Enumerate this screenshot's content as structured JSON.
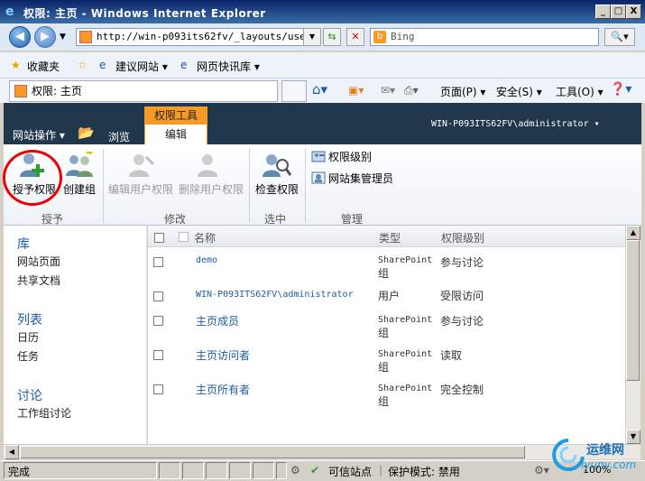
{
  "window": {
    "title": "权限: 主页 - Windows Internet Explorer",
    "min": "_",
    "max": "□",
    "close": "X"
  },
  "nav": {
    "address": "http://win-p093its62fv/_layouts/user.a",
    "search_placeholder": "Bing"
  },
  "favorites": {
    "label": "收藏夹",
    "items": [
      "建议网站 ▾",
      "网页快讯库 ▾"
    ]
  },
  "tab": {
    "title": "权限: 主页"
  },
  "commands": {
    "page": "页面(P) ▾",
    "safety": "安全(S) ▾",
    "tools": "工具(O) ▾"
  },
  "sharepoint": {
    "site_actions": "网站操作 ▾",
    "browse": "浏览",
    "tool_context": "权限工具",
    "edit_tab": "编辑",
    "user": "WIN-P093ITS62FV\\administrator ▾"
  },
  "ribbon": {
    "grant": "授予权限",
    "create_group": "创建组",
    "edit_perm": "编辑用户权限",
    "remove_perm": "删除用户权限",
    "check_perm": "检查权限",
    "perm_levels": "权限级别",
    "site_admins": "网站集管理员",
    "groups": {
      "grant": "授予",
      "modify": "修改",
      "check": "选中",
      "manage": "管理"
    }
  },
  "leftnav": {
    "libraries": "库",
    "lib_items": [
      "网站页面",
      "共享文档"
    ],
    "lists": "列表",
    "list_items": [
      "日历",
      "任务"
    ],
    "discussions": "讨论",
    "disc_items": [
      "工作组讨论"
    ]
  },
  "list": {
    "headers": {
      "name": "名称",
      "type": "类型",
      "level": "权限级别"
    },
    "rows": [
      {
        "name": "demo",
        "type": [
          "SharePoint",
          "组"
        ],
        "level": "参与讨论"
      },
      {
        "name": "WIN-P093ITS62FV\\administrator",
        "type": [
          "用户"
        ],
        "level": "受限访问"
      },
      {
        "name": "主页成员",
        "type": [
          "SharePoint",
          "组"
        ],
        "level": "参与讨论"
      },
      {
        "name": "主页访问者",
        "type": [
          "SharePoint",
          "组"
        ],
        "level": "读取"
      },
      {
        "name": "主页所有者",
        "type": [
          "SharePoint",
          "组"
        ],
        "level": "完全控制"
      }
    ]
  },
  "status": {
    "done": "完成",
    "zone": "可信站点",
    "protected": "保护模式: 禁用",
    "zoom": "100%"
  },
  "watermark": {
    "cn": "运维网",
    "url": "iyunv.com"
  },
  "colors": {
    "ribbon_dark": "#21374c",
    "context_orange": "#f79b27",
    "link_blue": "#1a5ca8",
    "highlight_red": "#e00000"
  }
}
